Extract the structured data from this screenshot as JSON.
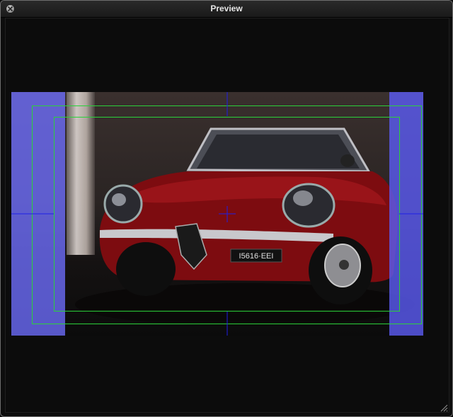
{
  "window": {
    "title": "Preview"
  },
  "preview": {
    "subject": "red convertible car",
    "plate_text": "I5616·EEI",
    "colors": {
      "title_text": "#e6e6e6",
      "guide_green": "#2bd13a",
      "crosshair_blue": "#1f1fe6",
      "letterbox_blue": "#6e6eff",
      "car_red": "#8a0f12"
    }
  },
  "icons": {
    "close": "close-icon",
    "resize": "resize-grip-icon"
  }
}
